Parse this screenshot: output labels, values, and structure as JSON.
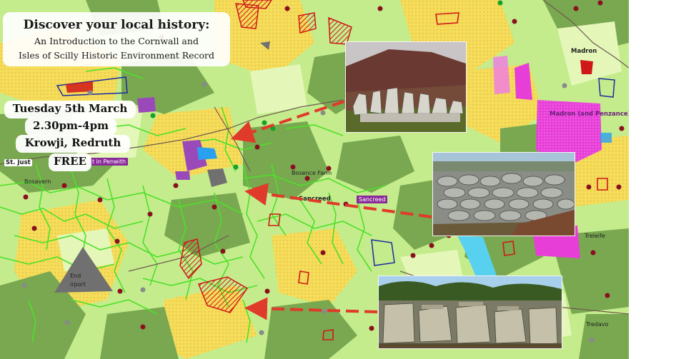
{
  "title_card": {
    "heading": "Discover your local history:",
    "subtitle_line1": "An Introduction to the Cornwall and",
    "subtitle_line2": "Isles of Scilly Historic Environment Record"
  },
  "event": {
    "date": "Tuesday 5th March",
    "time": "2.30pm-4pm",
    "venue": "Krowji, Redruth",
    "price": "FREE"
  },
  "map_labels": {
    "madron": "Madron",
    "madron_penzance": "Madron (and Penzance)",
    "st_just": "St. Just",
    "penwith": "t in Penwith",
    "sancreed": "Sancreed",
    "sancreed_tag": "Sancreed",
    "bosavern": "Bosavern",
    "end": "End",
    "airport": "irport",
    "treleife": "Treleife",
    "tredavo": "Tredavo",
    "boscawen": "Bosence Farm"
  },
  "photos": [
    {
      "subject": "stone-hedge-moorland"
    },
    {
      "subject": "dry-stone-wall"
    },
    {
      "subject": "grown-over-stone-hedge"
    }
  ],
  "colors": {
    "map_green_light": "#c4ec8c",
    "map_green_dark": "#79a850",
    "map_yellow": "#f5dd5a",
    "hedge_green": "#4ee02a",
    "site_red": "#d01818",
    "arrow_red": "#e03a2a",
    "dot_maroon": "#8a1020",
    "dot_grey": "#8a8a8a",
    "magenta": "#e83ed8",
    "purple": "#8a3aa8"
  }
}
